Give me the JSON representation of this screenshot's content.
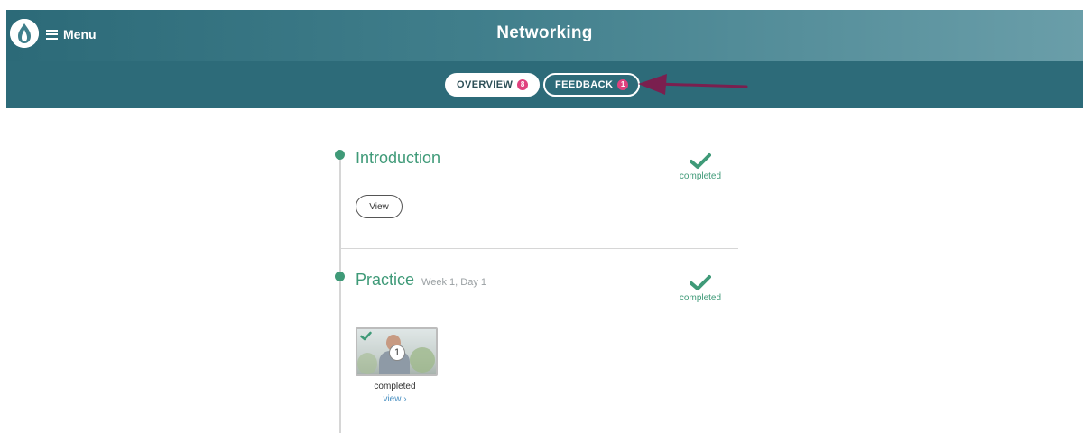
{
  "header": {
    "menu_label": "Menu",
    "title": "Networking"
  },
  "tabs": [
    {
      "label": "OVERVIEW",
      "badge": "8",
      "active": true
    },
    {
      "label": "FEEDBACK",
      "badge": "1",
      "active": false
    }
  ],
  "sections": [
    {
      "title": "Introduction",
      "subtitle": "",
      "status": "completed",
      "button_label": "View"
    },
    {
      "title": "Practice",
      "subtitle": "Week 1, Day 1",
      "status": "completed",
      "item": {
        "number": "1",
        "caption": "completed",
        "link_label": "view ›"
      }
    }
  ],
  "colors": {
    "header": "#417f8c",
    "subbar": "#2d6b79",
    "accent_green": "#3f9a78",
    "badge": "#e0417e",
    "annotation_arrow": "#7a1f4f",
    "link": "#4a90c2"
  }
}
